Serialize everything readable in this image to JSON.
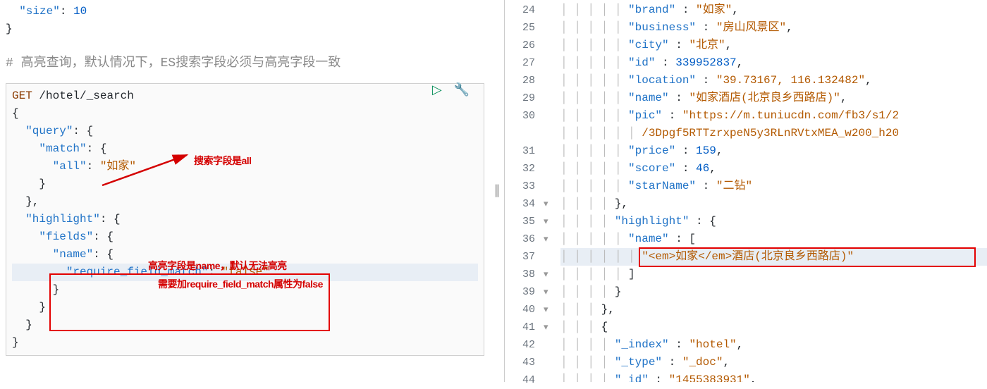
{
  "top_snippet": {
    "line1_key": "\"size\"",
    "line1_val": "10",
    "line2": "}"
  },
  "comment": "# 高亮查询，默认情况下，ES搜索字段必须与高亮字段一致",
  "request": {
    "method": "GET",
    "path": "/hotel/_search",
    "query_key": "\"query\"",
    "match_key": "\"match\"",
    "all_key": "\"all\"",
    "all_val": "\"如家\"",
    "highlight_key": "\"highlight\"",
    "fields_key": "\"fields\"",
    "name_key": "\"name\"",
    "rfm_key": "\"require_field_match\"",
    "rfm_val": "\"false\""
  },
  "annotations": {
    "search_field": "搜索字段是all",
    "highlight_field": "高亮字段是name，默认无法高亮",
    "require_prop": "需要加require_field_match属性为false"
  },
  "response": {
    "lines": [
      {
        "n": 24,
        "indent": 5,
        "content": [
          {
            "t": "key",
            "v": "\"brand\""
          },
          {
            "t": "punc",
            "v": " : "
          },
          {
            "t": "str",
            "v": "\"如家\""
          },
          {
            "t": "punc",
            "v": ","
          }
        ]
      },
      {
        "n": 25,
        "indent": 5,
        "content": [
          {
            "t": "key",
            "v": "\"business\""
          },
          {
            "t": "punc",
            "v": " : "
          },
          {
            "t": "str",
            "v": "\"房山风景区\""
          },
          {
            "t": "punc",
            "v": ","
          }
        ]
      },
      {
        "n": 26,
        "indent": 5,
        "content": [
          {
            "t": "key",
            "v": "\"city\""
          },
          {
            "t": "punc",
            "v": " : "
          },
          {
            "t": "str",
            "v": "\"北京\""
          },
          {
            "t": "punc",
            "v": ","
          }
        ]
      },
      {
        "n": 27,
        "indent": 5,
        "content": [
          {
            "t": "key",
            "v": "\"id\""
          },
          {
            "t": "punc",
            "v": " : "
          },
          {
            "t": "num",
            "v": "339952837"
          },
          {
            "t": "punc",
            "v": ","
          }
        ]
      },
      {
        "n": 28,
        "indent": 5,
        "content": [
          {
            "t": "key",
            "v": "\"location\""
          },
          {
            "t": "punc",
            "v": " : "
          },
          {
            "t": "str",
            "v": "\"39.73167, 116.132482\""
          },
          {
            "t": "punc",
            "v": ","
          }
        ]
      },
      {
        "n": 29,
        "indent": 5,
        "content": [
          {
            "t": "key",
            "v": "\"name\""
          },
          {
            "t": "punc",
            "v": " : "
          },
          {
            "t": "str",
            "v": "\"如家酒店(北京良乡西路店)\""
          },
          {
            "t": "punc",
            "v": ","
          }
        ]
      },
      {
        "n": 30,
        "indent": 5,
        "content": [
          {
            "t": "key",
            "v": "\"pic\""
          },
          {
            "t": "punc",
            "v": " : "
          },
          {
            "t": "str",
            "v": "\"https://m.tuniucdn.com/fb3/s1/2"
          }
        ]
      },
      {
        "n": "",
        "indent": 6,
        "content": [
          {
            "t": "str",
            "v": "/3Dpgf5RTTzrxpeN5y3RLnRVtxMEA_w200_h20"
          }
        ]
      },
      {
        "n": 31,
        "indent": 5,
        "content": [
          {
            "t": "key",
            "v": "\"price\""
          },
          {
            "t": "punc",
            "v": " : "
          },
          {
            "t": "num",
            "v": "159"
          },
          {
            "t": "punc",
            "v": ","
          }
        ]
      },
      {
        "n": 32,
        "indent": 5,
        "content": [
          {
            "t": "key",
            "v": "\"score\""
          },
          {
            "t": "punc",
            "v": " : "
          },
          {
            "t": "num",
            "v": "46"
          },
          {
            "t": "punc",
            "v": ","
          }
        ]
      },
      {
        "n": 33,
        "indent": 5,
        "content": [
          {
            "t": "key",
            "v": "\"starName\""
          },
          {
            "t": "punc",
            "v": " : "
          },
          {
            "t": "str",
            "v": "\"二钻\""
          }
        ]
      },
      {
        "n": 34,
        "fold": "▾",
        "indent": 4,
        "content": [
          {
            "t": "punc",
            "v": "},"
          }
        ]
      },
      {
        "n": 35,
        "fold": "▾",
        "indent": 4,
        "content": [
          {
            "t": "key",
            "v": "\"highlight\""
          },
          {
            "t": "punc",
            "v": " : {"
          }
        ]
      },
      {
        "n": 36,
        "fold": "▾",
        "indent": 5,
        "content": [
          {
            "t": "key",
            "v": "\"name\""
          },
          {
            "t": "punc",
            "v": " : ["
          }
        ]
      },
      {
        "n": 37,
        "indent": 6,
        "hl": true,
        "content": [
          {
            "t": "str",
            "v": "\"<em>如家</em>酒店(北京良乡西路店)\""
          }
        ]
      },
      {
        "n": 38,
        "fold": "▾",
        "indent": 5,
        "content": [
          {
            "t": "punc",
            "v": "]"
          }
        ]
      },
      {
        "n": 39,
        "fold": "▾",
        "indent": 4,
        "content": [
          {
            "t": "punc",
            "v": "}"
          }
        ]
      },
      {
        "n": 40,
        "fold": "▾",
        "indent": 3,
        "content": [
          {
            "t": "punc",
            "v": "},"
          }
        ]
      },
      {
        "n": 41,
        "fold": "▾",
        "indent": 3,
        "content": [
          {
            "t": "punc",
            "v": "{"
          }
        ]
      },
      {
        "n": 42,
        "indent": 4,
        "content": [
          {
            "t": "key",
            "v": "\"_index\""
          },
          {
            "t": "punc",
            "v": " : "
          },
          {
            "t": "str",
            "v": "\"hotel\""
          },
          {
            "t": "punc",
            "v": ","
          }
        ]
      },
      {
        "n": 43,
        "indent": 4,
        "content": [
          {
            "t": "key",
            "v": "\"_type\""
          },
          {
            "t": "punc",
            "v": " : "
          },
          {
            "t": "str",
            "v": "\"_doc\""
          },
          {
            "t": "punc",
            "v": ","
          }
        ]
      },
      {
        "n": 44,
        "indent": 4,
        "content": [
          {
            "t": "key",
            "v": "\"_id\""
          },
          {
            "t": "punc",
            "v": " : "
          },
          {
            "t": "str",
            "v": "\"1455383931\""
          },
          {
            "t": "punc",
            "v": ","
          }
        ]
      }
    ]
  }
}
